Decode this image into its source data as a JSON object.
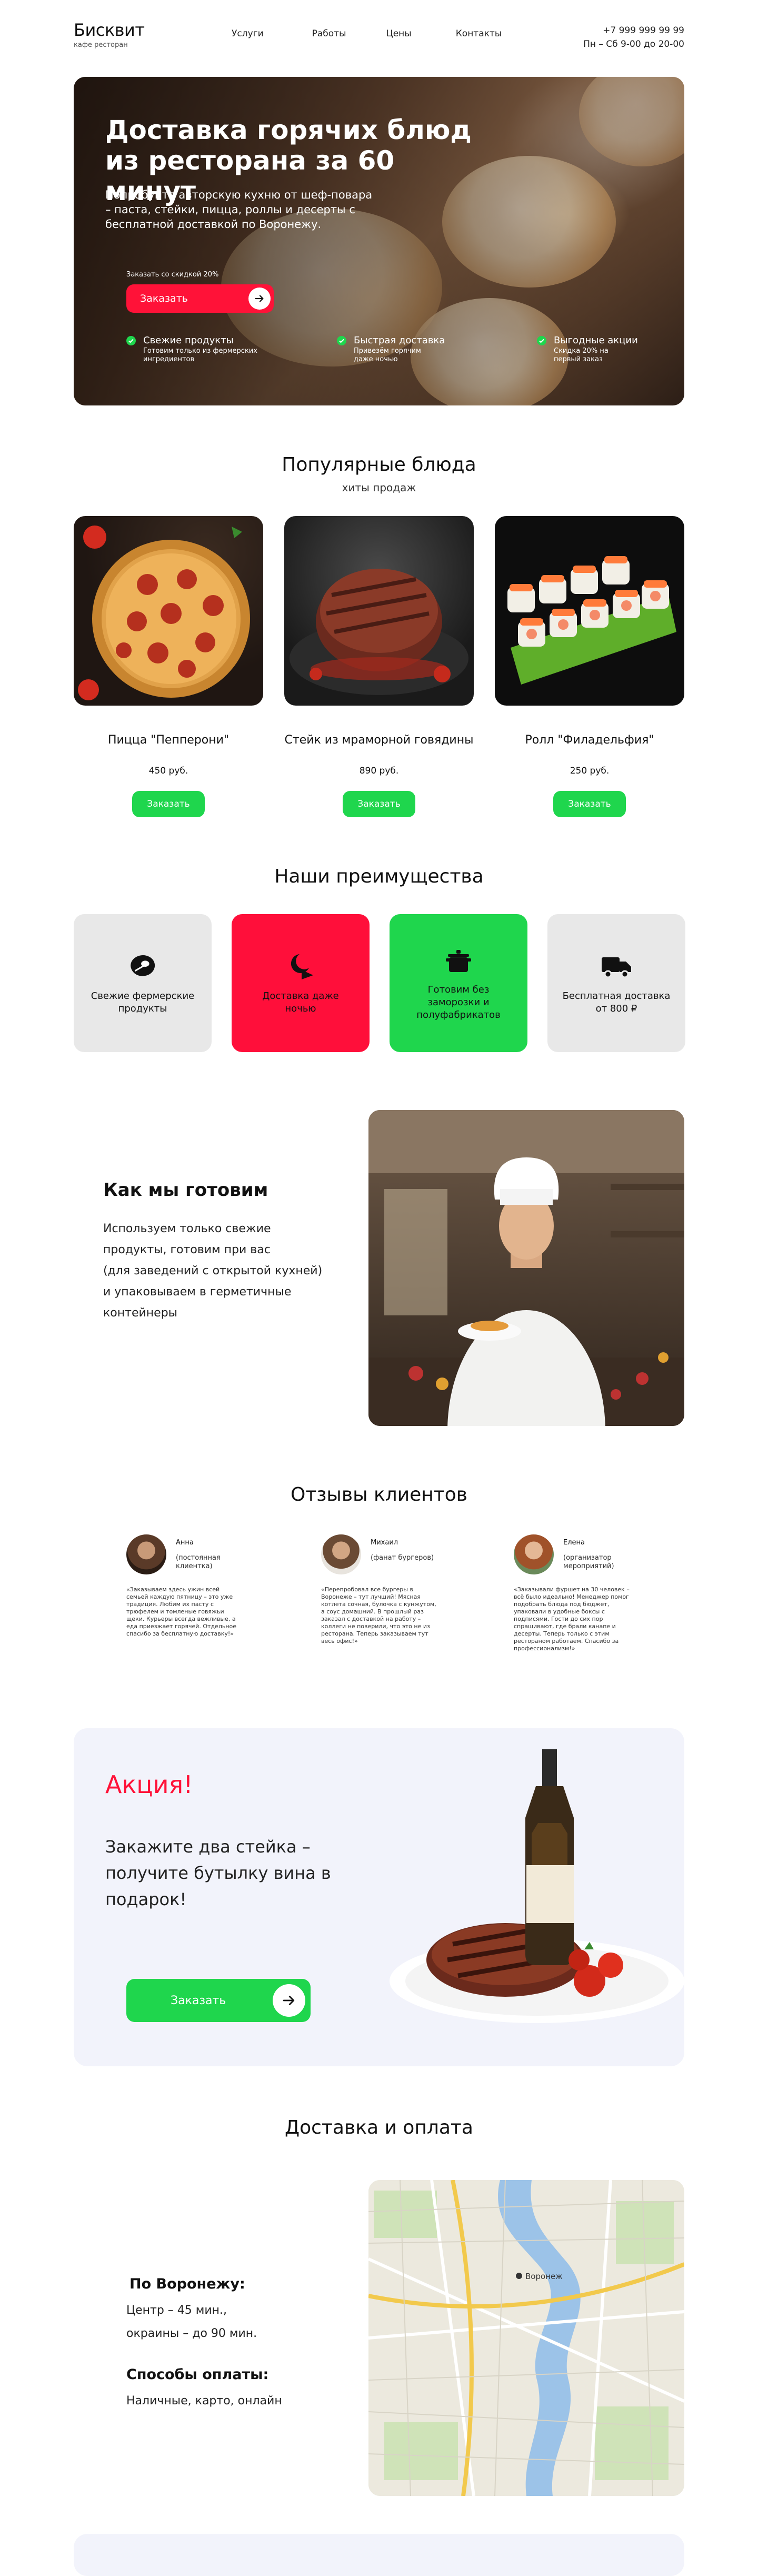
{
  "header": {
    "logo_name": "Бисквит",
    "logo_sub": "кафе ресторан",
    "nav": [
      "Услуги",
      "Работы",
      "Цены",
      "Контакты"
    ],
    "phone": "+7 999 999 99 99",
    "hours": "Пн – Сб 9-00 до 20-00"
  },
  "hero": {
    "title": "Доставка горячих блюд из ресторана за 60 минут",
    "lead": "Попробуйте авторскую кухню от шеф-повара – паста, стейки, пицца, роллы и десерты с бесплатной доставкой по Воронежу.",
    "discount_note": "Заказать со скидкой 20%",
    "order_button": "Заказать",
    "features": [
      {
        "title": "Свежие продукты",
        "sub": "Готовим только из фермерских ингредиентов"
      },
      {
        "title": "Быстрая доставка",
        "sub": "Привезём горячим даже ночью"
      },
      {
        "title": "Выгодные акции",
        "sub": "Скидка 20% на первый заказ"
      }
    ]
  },
  "popular": {
    "title": "Популярные блюда",
    "subtitle": "хиты продаж",
    "items": [
      {
        "name": "Пицца \"Пепперони\"",
        "price": "450 руб.",
        "button": "Заказать"
      },
      {
        "name": "Стейк из мраморной говядины",
        "price": "890 руб.",
        "button": "Заказать"
      },
      {
        "name": "Ролл \"Филадельфия\"",
        "price": "250 руб.",
        "button": "Заказать"
      }
    ]
  },
  "advantages": {
    "title": "Наши преимущества",
    "items": [
      {
        "label": "Свежие фермерские продукты",
        "bg": "#e8e8e8",
        "color": "#111111"
      },
      {
        "label": "Доставка даже ночью",
        "bg": "#ff0f3a",
        "color": "#111111"
      },
      {
        "label": "Готовим без заморозки и полуфабрикатов",
        "bg": "#1fd64d",
        "color": "#111111"
      },
      {
        "label": "Бесплатная доставка от 800 ₽",
        "bg": "#e8e8e8",
        "color": "#111111"
      }
    ]
  },
  "cook": {
    "title": "Как мы готовим",
    "text": "Используем только свежие\nпродукты, готовим при вас\n(для заведений с открытой кухней)\n и упаковываем в герметичные\n контейнеры"
  },
  "reviews": {
    "title": "Отзывы клиентов",
    "items": [
      {
        "name": "Анна",
        "role": "(постоянная клиентка)",
        "text": "«Заказываем здесь ужин всей семьей каждую пятницу – это уже традиция. Любим их пасту с трюфелем и томленые говяжьи щеки. Курьеры всегда вежливые, а еда приезжает горячей. Отдельное спасибо за бесплатную доставку!»"
      },
      {
        "name": "Михаил",
        "role": "(фанат бургеров)",
        "text": "«Перепробовал все бургеры в Воронеже – тут лучший! Мясная котлета сочная, булочка с кунжутом, а соус домашний. В прошлый раз заказал с доставкой на работу – коллеги не поверили, что это не из ресторана. Теперь заказываем тут весь офис!»"
      },
      {
        "name": "Елена",
        "role": "(организатор мероприятий)",
        "text": "«Заказывали фуршет на 30 человек – всё было идеально! Менеджер помог подобрать блюда под бюджет, упаковали в удобные боксы с подписями. Гости до сих пор спрашивают, где брали канапе и десерты. Теперь только с этим рестораном работаем. Спасибо за профессионализм!»"
      }
    ]
  },
  "promo": {
    "title": "Акция!",
    "text": "Закажите два стейка – получите бутылку вина в подарок!",
    "button": "Заказать"
  },
  "delivery": {
    "title": "Доставка и оплата",
    "area_title": "По Воронежу:",
    "area_text_1": "Центр – 45 мин.,",
    "area_text_2": "окраины – до 90 мин.",
    "pay_title": "Способы оплаты:",
    "pay_text": "Наличные, карто, онлайн",
    "map_labels": [
      "Воронеж"
    ]
  }
}
